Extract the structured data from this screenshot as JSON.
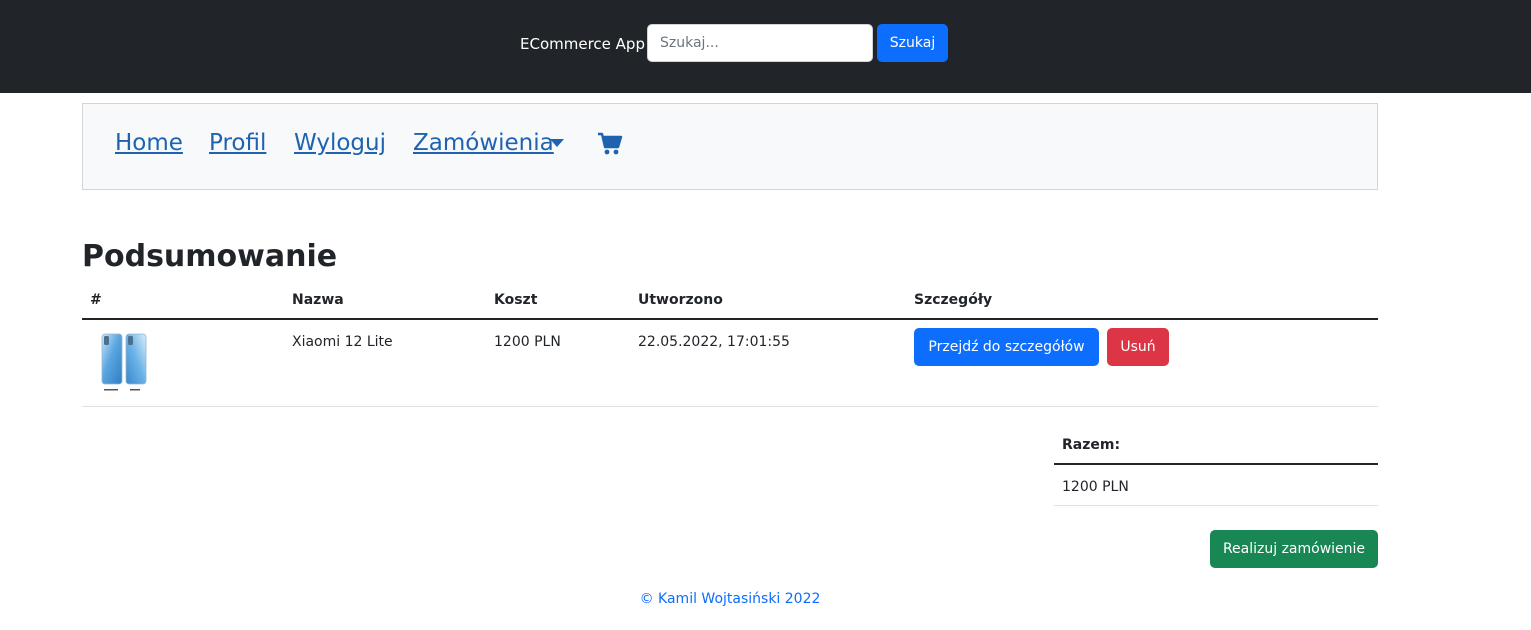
{
  "header": {
    "brand": "ECommerce App",
    "search": {
      "placeholder": "Szukaj...",
      "value": ""
    },
    "search_button": "Szukaj"
  },
  "nav": {
    "items": [
      {
        "label": "Home"
      },
      {
        "label": "Profil"
      },
      {
        "label": "Wyloguj"
      },
      {
        "label": "Zamówienia",
        "has_dropdown": true
      }
    ],
    "cart_icon": "shopping-cart-icon"
  },
  "main": {
    "title": "Podsumowanie",
    "table": {
      "columns": [
        "#",
        "Nazwa",
        "Koszt",
        "Utworzono",
        "Szczegóły"
      ],
      "rows": [
        {
          "image": "product-thumbnail-phone",
          "name": "Xiaomi 12 Lite",
          "cost": "1200 PLN",
          "created": "22.05.2022, 17:01:55",
          "details_button": "Przejdź do szczegółów",
          "remove_button": "Usuń"
        }
      ]
    },
    "total": {
      "label": "Razem:",
      "value": "1200 PLN"
    },
    "checkout_button": "Realizuj zamówienie"
  },
  "footer": {
    "text": "© Kamil Wojtasiński 2022"
  },
  "colors": {
    "topbar": "#212529",
    "primary": "#0d6efd",
    "danger": "#dc3545",
    "success": "#198754",
    "nav_link": "#1f63b0"
  }
}
